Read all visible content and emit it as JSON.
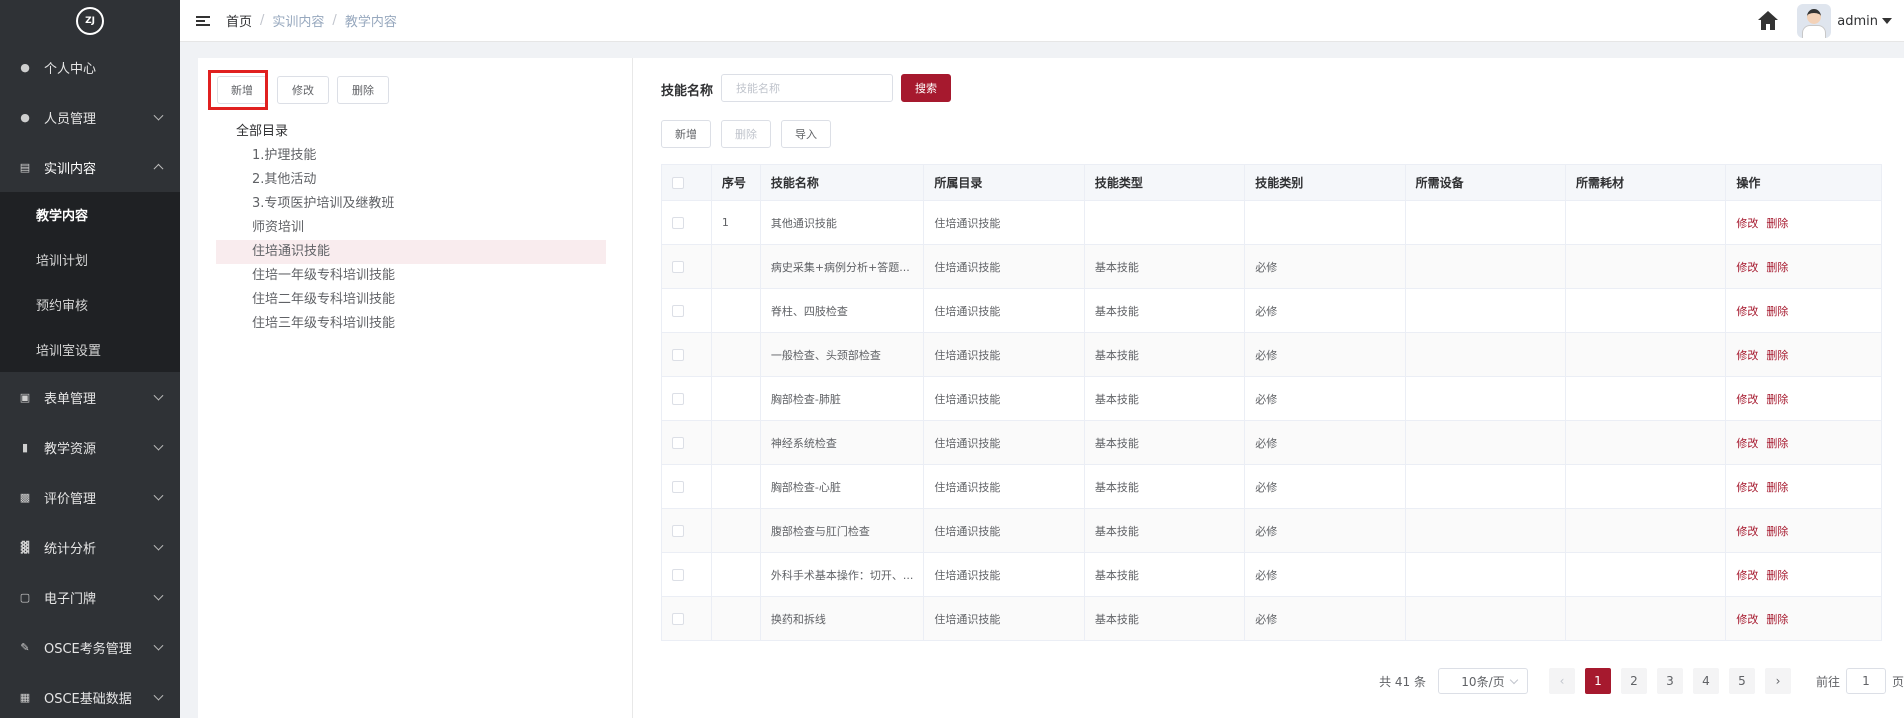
{
  "logo_text": "ZJ",
  "sidebar": {
    "items": [
      {
        "label": "个人中心",
        "icon": "user-icon"
      },
      {
        "label": "人员管理",
        "icon": "users-icon"
      },
      {
        "label": "实训内容",
        "icon": "book-icon"
      },
      {
        "label": "表单管理",
        "icon": "form-icon"
      },
      {
        "label": "教学资源",
        "icon": "resource-icon"
      },
      {
        "label": "评价管理",
        "icon": "evaluate-icon"
      },
      {
        "label": "统计分析",
        "icon": "bar-chart-icon"
      },
      {
        "label": "电子门牌",
        "icon": "monitor-icon"
      },
      {
        "label": "OSCE考务管理",
        "icon": "document-icon"
      },
      {
        "label": "OSCE基础数据",
        "icon": "grid-icon"
      }
    ],
    "submenu": [
      "教学内容",
      "培训计划",
      "预约审核",
      "培训室设置"
    ]
  },
  "header": {
    "breadcrumb": [
      "首页",
      "实训内容",
      "教学内容"
    ],
    "user": "admin"
  },
  "left": {
    "buttons": {
      "add": "新增",
      "edit": "修改",
      "delete": "删除"
    },
    "tree_root": "全部目录",
    "tree": [
      "1.护理技能",
      "2.其他活动",
      "3.专项医护培训及继教班",
      "师资培训",
      "住培通识技能",
      "住培一年级专科培训技能",
      "住培二年级专科培训技能",
      "住培三年级专科培训技能"
    ]
  },
  "right": {
    "search_label": "技能名称",
    "search_placeholder": "技能名称",
    "search_button": "搜索",
    "toolbar": {
      "add": "新增",
      "delete": "删除",
      "import": "导入"
    },
    "columns": [
      "序号",
      "技能名称",
      "所属目录",
      "技能类型",
      "技能类别",
      "所需设备",
      "所需耗材",
      "操作"
    ],
    "rows": [
      {
        "no": "1",
        "name": "其他通识技能",
        "dir": "住培通识技能",
        "type": "",
        "cat": ""
      },
      {
        "no": "",
        "name": "病史采集+病例分析+答题...",
        "dir": "住培通识技能",
        "type": "基本技能",
        "cat": "必修"
      },
      {
        "no": "",
        "name": "脊柱、四肢检查",
        "dir": "住培通识技能",
        "type": "基本技能",
        "cat": "必修"
      },
      {
        "no": "",
        "name": "一般检查、头颈部检查",
        "dir": "住培通识技能",
        "type": "基本技能",
        "cat": "必修"
      },
      {
        "no": "",
        "name": "胸部检查-肺脏",
        "dir": "住培通识技能",
        "type": "基本技能",
        "cat": "必修"
      },
      {
        "no": "",
        "name": "神经系统检查",
        "dir": "住培通识技能",
        "type": "基本技能",
        "cat": "必修"
      },
      {
        "no": "",
        "name": "胸部检查-心脏",
        "dir": "住培通识技能",
        "type": "基本技能",
        "cat": "必修"
      },
      {
        "no": "",
        "name": "腹部检查与肛门检查",
        "dir": "住培通识技能",
        "type": "基本技能",
        "cat": "必修"
      },
      {
        "no": "",
        "name": "外科手术基本操作：切开、...",
        "dir": "住培通识技能",
        "type": "基本技能",
        "cat": "必修"
      },
      {
        "no": "",
        "name": "换药和拆线",
        "dir": "住培通识技能",
        "type": "基本技能",
        "cat": "必修"
      }
    ],
    "op_edit": "修改",
    "op_delete": "删除",
    "pager": {
      "total": "共 41 条",
      "size": "10条/页",
      "pages": [
        "1",
        "2",
        "3",
        "4",
        "5"
      ],
      "goto_prefix": "前往",
      "goto_value": "1",
      "goto_suffix": "页"
    }
  },
  "colors": {
    "accent": "#a6192e",
    "sidebar_bg": "#2f3236",
    "submenu_bg": "#1f2124"
  }
}
